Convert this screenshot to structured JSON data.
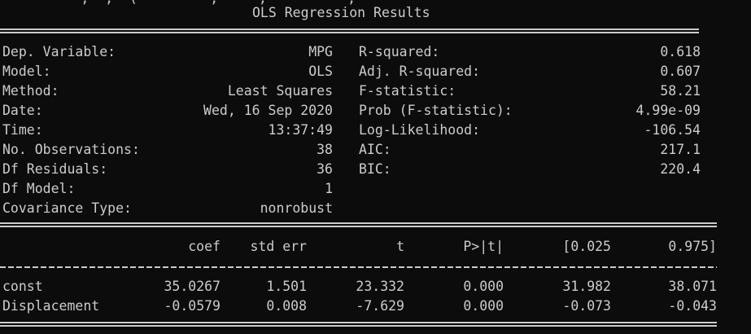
{
  "cutoff_text": "          ,  ,  (         ,     ,          ,",
  "title": "OLS Regression Results",
  "summary_left": [
    {
      "label": "Dep. Variable:",
      "value": "MPG"
    },
    {
      "label": "Model:",
      "value": "OLS"
    },
    {
      "label": "Method:",
      "value": "Least Squares"
    },
    {
      "label": "Date:",
      "value": "Wed, 16 Sep 2020"
    },
    {
      "label": "Time:",
      "value": "13:37:49"
    },
    {
      "label": "No. Observations:",
      "value": "38"
    },
    {
      "label": "Df Residuals:",
      "value": "36"
    },
    {
      "label": "Df Model:",
      "value": "1"
    },
    {
      "label": "Covariance Type:",
      "value": "nonrobust"
    }
  ],
  "summary_right": [
    {
      "label": "R-squared:",
      "value": "0.618"
    },
    {
      "label": "Adj. R-squared:",
      "value": "0.607"
    },
    {
      "label": "F-statistic:",
      "value": "58.21"
    },
    {
      "label": "Prob (F-statistic):",
      "value": "4.99e-09"
    },
    {
      "label": "Log-Likelihood:",
      "value": "-106.54"
    },
    {
      "label": "AIC:",
      "value": "217.1"
    },
    {
      "label": "BIC:",
      "value": "220.4"
    }
  ],
  "coef_table": {
    "headers": [
      "",
      "coef",
      "std err",
      "t",
      "P>|t|",
      "[0.025",
      "0.975]"
    ],
    "rows": [
      [
        "const",
        "35.0267",
        "1.501",
        "23.332",
        "0.000",
        "31.982",
        "38.071"
      ],
      [
        "Displacement",
        "-0.0579",
        "0.008",
        "-7.629",
        "0.000",
        "-0.073",
        "-0.043"
      ]
    ]
  },
  "colors": {
    "background": "#0c0c0c",
    "text": "#cccccc"
  }
}
